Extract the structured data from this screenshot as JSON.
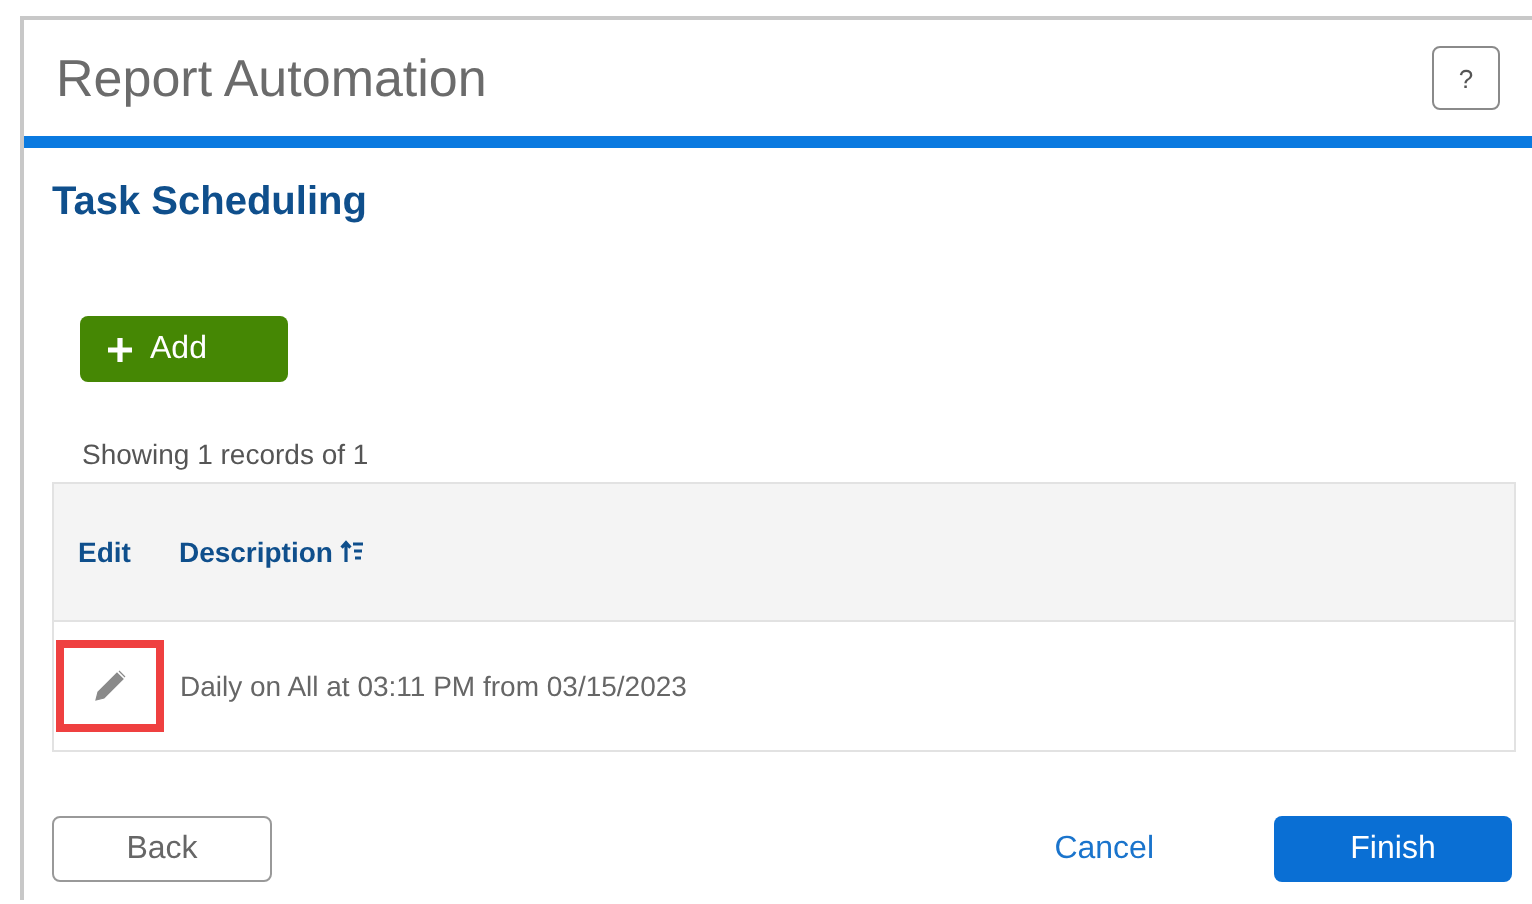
{
  "window": {
    "title": "Report Automation",
    "help": "?"
  },
  "section": {
    "title": "Task Scheduling"
  },
  "add_button": {
    "label": "Add"
  },
  "record_count": "Showing 1 records of 1",
  "table": {
    "columns": [
      {
        "label": "Edit",
        "sortable": false
      },
      {
        "label": "Description",
        "sortable": true
      }
    ],
    "rows": [
      {
        "description": "Daily on All at 03:11 PM from 03/15/2023",
        "highlighted": true
      }
    ]
  },
  "footer": {
    "back": "Back",
    "cancel": "Cancel",
    "finish": "Finish"
  }
}
